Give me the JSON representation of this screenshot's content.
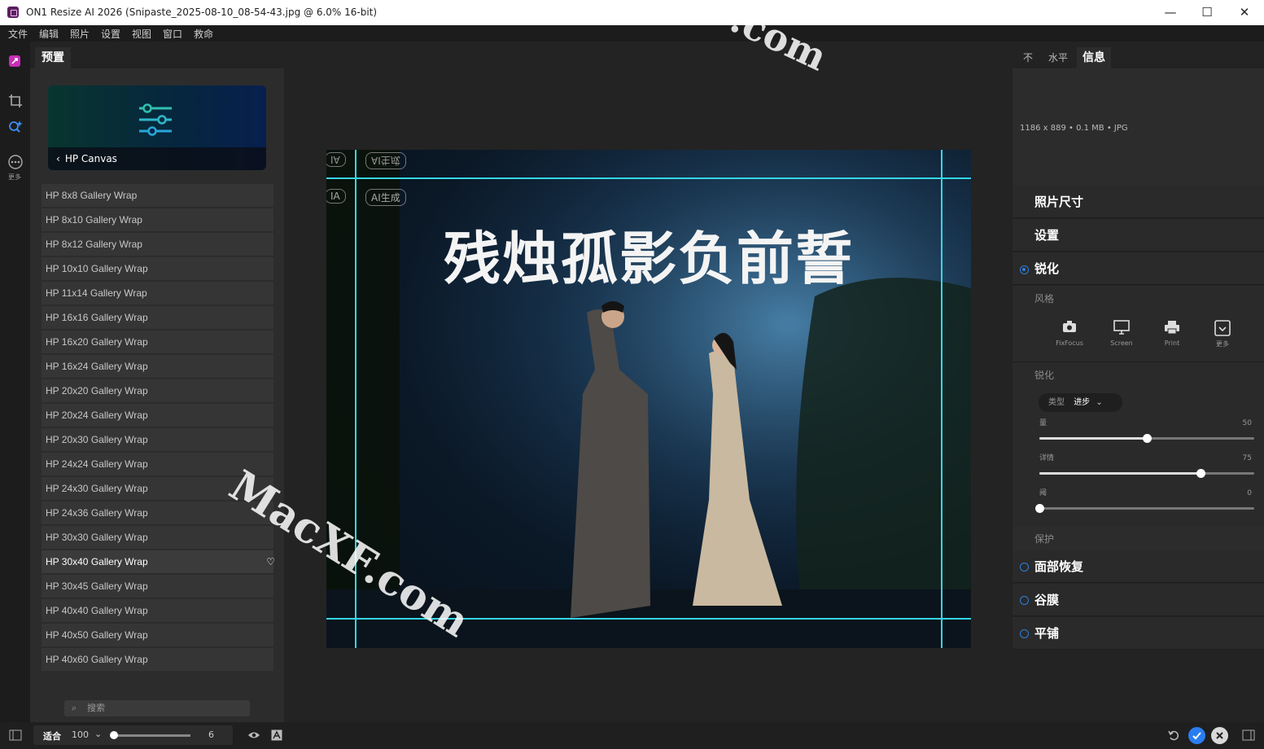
{
  "window": {
    "title": "ON1 Resize AI 2026 (Snipaste_2025-08-10_08-54-43.jpg @ 6.0% 16-bit)",
    "minimize": "—",
    "maximize": "☐",
    "close": "✕"
  },
  "menu": [
    "文件",
    "编辑",
    "照片",
    "设置",
    "视图",
    "窗口",
    "救命"
  ],
  "toolstrip": {
    "more_label": "更多"
  },
  "left_panel": {
    "tab": "预置",
    "card_title": "HP Canvas",
    "presets": [
      "HP 8x8 Gallery Wrap",
      "HP 8x10 Gallery Wrap",
      "HP 8x12 Gallery Wrap",
      "HP 10x10 Gallery Wrap",
      "HP 11x14 Gallery Wrap",
      "HP 16x16 Gallery Wrap",
      "HP 16x20 Gallery Wrap",
      "HP 16x24 Gallery Wrap",
      "HP 20x20 Gallery Wrap",
      "HP 20x24 Gallery Wrap",
      "HP 20x30 Gallery Wrap",
      "HP 24x24 Gallery Wrap",
      "HP 24x30 Gallery Wrap",
      "HP 24x36 Gallery Wrap",
      "HP 30x30 Gallery Wrap",
      "HP 30x40 Gallery Wrap",
      "HP 30x45 Gallery Wrap",
      "HP 40x40 Gallery Wrap",
      "HP 40x50 Gallery Wrap",
      "HP 40x60 Gallery Wrap"
    ],
    "active_preset": "HP 30x40 Gallery Wrap",
    "search_placeholder": "搜索"
  },
  "bottom_bar": {
    "fit_label": "适合",
    "zoom_value": "100",
    "slider_value": "6",
    "slider_fraction": 0.0
  },
  "image": {
    "headline": "残烛孤影负前誓",
    "badge_ai": "AI生成",
    "badge_ai_mirror": "AI生成",
    "badge_ia": "IA",
    "badge_ia2": "IA"
  },
  "watermarks": {
    "top": ".com",
    "center": "MacXF.com"
  },
  "right_panel": {
    "tabs": [
      "不",
      "水平",
      "信息"
    ],
    "active_tab": "信息",
    "file_info": "1186 x 889 • 0.1 MB • JPG",
    "photo_size": "照片尺寸",
    "settings": "设置",
    "sharpen": {
      "title": "锐化",
      "style_label": "风格",
      "styles": [
        {
          "label": "FixFocus",
          "icon": "camera-icon"
        },
        {
          "label": "Screen",
          "icon": "monitor-icon"
        },
        {
          "label": "Print",
          "icon": "printer-icon"
        },
        {
          "label": "更多",
          "icon": "more-icon"
        }
      ],
      "sharpen_label": "锐化",
      "type_label": "类型",
      "type_value": "进步",
      "sliders": [
        {
          "label": "量",
          "value": 50,
          "max": 100
        },
        {
          "label": "详情",
          "value": 75,
          "max": 100
        },
        {
          "label": "阈",
          "value": 0,
          "max": 100
        }
      ],
      "protect_label": "保护"
    },
    "face_recovery": "面部恢复",
    "film_grain": "谷膜",
    "tiling": "平铺"
  },
  "colors": {
    "accent": "#2d7fe0",
    "guide": "#35d6e6",
    "panel": "#2c2c2c",
    "background": "#232323"
  }
}
